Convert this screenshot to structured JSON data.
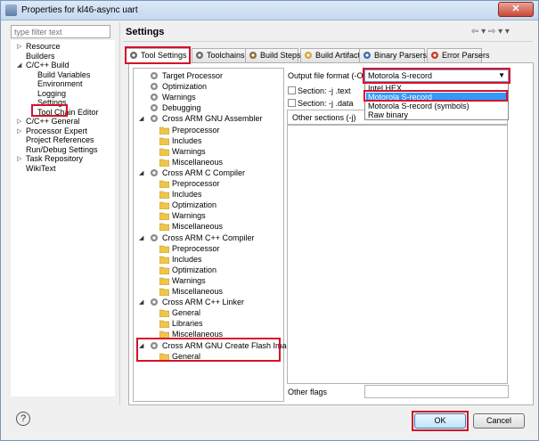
{
  "window": {
    "title": "Properties for kl46-async uart",
    "close_glyph": "✕"
  },
  "filter": {
    "placeholder": "type filter text"
  },
  "nav": [
    {
      "label": "Resource",
      "arrow": "▷"
    },
    {
      "label": "Builders",
      "arrow": ""
    },
    {
      "label": "C/C++ Build",
      "arrow": "◢"
    },
    {
      "label": "Build Variables",
      "arrow": ""
    },
    {
      "label": "Environment",
      "arrow": ""
    },
    {
      "label": "Logging",
      "arrow": ""
    },
    {
      "label": "Settings",
      "arrow": ""
    },
    {
      "label": "Tool Chain Editor",
      "arrow": ""
    },
    {
      "label": "C/C++ General",
      "arrow": "▷"
    },
    {
      "label": "Processor Expert",
      "arrow": "▷"
    },
    {
      "label": "Project References",
      "arrow": ""
    },
    {
      "label": "Run/Debug Settings",
      "arrow": ""
    },
    {
      "label": "Task Repository",
      "arrow": "▷"
    },
    {
      "label": "WikiText",
      "arrow": ""
    }
  ],
  "header": {
    "title": "Settings",
    "nav_icons": "⇦ ▾ ⇨ ▾ ▾"
  },
  "tabs": [
    {
      "label": "Tool Settings"
    },
    {
      "label": "Toolchains"
    },
    {
      "label": "Build Steps"
    },
    {
      "label": "Build Artifact"
    },
    {
      "label": "Binary Parsers"
    },
    {
      "label": "Error Parsers"
    }
  ],
  "tree": [
    "Target Processor",
    "Optimization",
    "Warnings",
    "Debugging",
    "Cross ARM GNU Assembler",
    "Preprocessor",
    "Includes",
    "Warnings",
    "Miscellaneous",
    "Cross ARM C Compiler",
    "Preprocessor",
    "Includes",
    "Optimization",
    "Warnings",
    "Miscellaneous",
    "Cross ARM C++ Compiler",
    "Preprocessor",
    "Includes",
    "Optimization",
    "Warnings",
    "Miscellaneous",
    "Cross ARM C++ Linker",
    "General",
    "Libraries",
    "Miscellaneous",
    "Cross ARM GNU Create Flash Image",
    "General"
  ],
  "form": {
    "output_format_label": "Output file format (-O)",
    "output_format_value": "Motorola S-record",
    "section_text_label": "Section: -j .text",
    "section_data_label": "Section: -j .data",
    "other_sections_label": "Other sections (-j)",
    "other_flags_label": "Other flags",
    "options": [
      "Intel HEX",
      "Motorola S-record",
      "Motorola S-record (symbols)",
      "Raw binary"
    ],
    "selected_option": "Motorola S-record"
  },
  "buttons": {
    "help": "?",
    "ok": "OK",
    "cancel": "Cancel"
  },
  "colors": {
    "highlight_red": "#d5112b",
    "selection_blue": "#3399ff",
    "folder_yellow": "#f0c54a"
  }
}
